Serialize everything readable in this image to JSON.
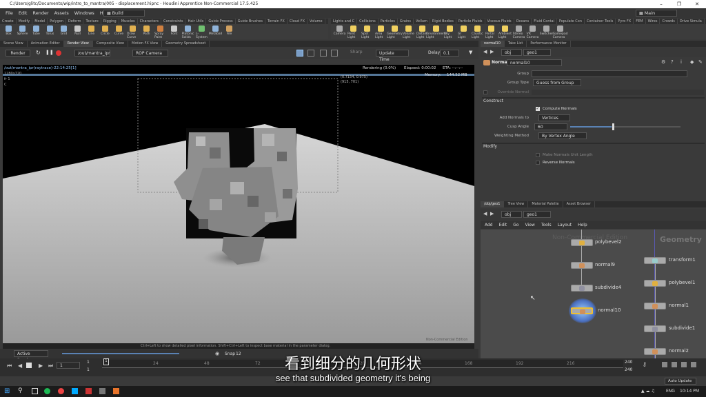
{
  "window": {
    "title": "C:/Users/glitc/Documents/wip/intro_to_mantra/005 - displacement.hipnc - Houdini Apprentice Non-Commercial 17.5.425"
  },
  "menu": [
    "File",
    "Edit",
    "Render",
    "Assets",
    "Windows",
    "Help"
  ],
  "desktop_left": "Build",
  "desktop_right": "Main",
  "shelf_tabs_left": [
    "Create",
    "Modify",
    "Model",
    "Polygon",
    "Deform",
    "Texture",
    "Rigging",
    "Muscles",
    "Characters",
    "Constraints",
    "Hair Utils",
    "Guide Process",
    "Guide Brushes",
    "Terrain FX",
    "Cloud FX",
    "Volume"
  ],
  "shelf_tools_left": [
    {
      "label": "Box",
      "color": "#8fb3d9"
    },
    {
      "label": "Sphere",
      "color": "#8fb3d9"
    },
    {
      "label": "Tube",
      "color": "#8fb3d9"
    },
    {
      "label": "Torus",
      "color": "#8fb3d9"
    },
    {
      "label": "Grid",
      "color": "#8fb3d9"
    },
    {
      "label": "Null",
      "color": "#c8c8c8"
    },
    {
      "label": "Line",
      "color": "#e0b050"
    },
    {
      "label": "Circle",
      "color": "#e0b050"
    },
    {
      "label": "Curve",
      "color": "#e0b050"
    },
    {
      "label": "Draw Curve",
      "color": "#e0b050"
    },
    {
      "label": "Path",
      "color": "#e0b050"
    },
    {
      "label": "Spray Paint",
      "color": "#d08040"
    },
    {
      "label": "Font",
      "color": "#cccccc"
    },
    {
      "label": "Platonic Solids",
      "color": "#8fb3d9"
    },
    {
      "label": "L-System",
      "color": "#70c070"
    },
    {
      "label": "Metaball",
      "color": "#8fb3d9"
    },
    {
      "label": "File",
      "color": "#d0a060"
    }
  ],
  "shelf_tabs_right": [
    "Lights and C",
    "Collisions",
    "Particles",
    "Grains",
    "Vellum",
    "Rigid Bodies",
    "Particle Fluids",
    "Viscous Fluids",
    "Oceans",
    "Fluid Contai",
    "Populate Con",
    "Container Tools",
    "Pyro FX",
    "FEM",
    "Wires",
    "Crowds",
    "Drive Simula"
  ],
  "shelf_tools_right": [
    {
      "label": "Camera",
      "color": "#aaaaaa"
    },
    {
      "label": "Point Light",
      "color": "#f0d060"
    },
    {
      "label": "Spot Light",
      "color": "#f0d060"
    },
    {
      "label": "Area Light",
      "color": "#f0d060"
    },
    {
      "label": "Geometry Light",
      "color": "#f0d060"
    },
    {
      "label": "Volume Light",
      "color": "#f0d060"
    },
    {
      "label": "Distant Light",
      "color": "#f0d060"
    },
    {
      "label": "Environment Light",
      "color": "#f0d060"
    },
    {
      "label": "Sky Light",
      "color": "#f0d060"
    },
    {
      "label": "GI Light",
      "color": "#f0d060"
    },
    {
      "label": "Caustic Light",
      "color": "#f0d060"
    },
    {
      "label": "Portal Light",
      "color": "#f0d060"
    },
    {
      "label": "Ambient Light",
      "color": "#f0d060"
    },
    {
      "label": "Stereo Camera",
      "color": "#aaaaaa"
    },
    {
      "label": "VR Camera",
      "color": "#aaaaaa"
    },
    {
      "label": "Switcher",
      "color": "#aaaaaa"
    },
    {
      "label": "Gamepad Camera",
      "color": "#aaaaaa"
    }
  ],
  "pane_tabs": [
    "Scene View",
    "Animation Editor",
    "Render View",
    "Composite View",
    "Motion FX View",
    "Geometry Spreadsheet"
  ],
  "render_toolbar": {
    "render_btn": "Render",
    "rop_path": "/out/mantra_ipr",
    "camera": "ROP Camera",
    "sharp": "Sharp",
    "update_time": "Update Time",
    "delay_label": "Delay",
    "delay_value": "0.1"
  },
  "viewer": {
    "path_info": "/out/mantra_ipr(raytrace)-22:14:25[1]",
    "resolution": "1280x720",
    "frame": "fr 1",
    "channel": "C",
    "rendering": "Rendering (0.0%)",
    "elapsed": "Elapsed: 0:00:02",
    "eta": "ETA: --:--:--",
    "memory": "Memory:",
    "memory_value": "144.52 MB",
    "pixel_coord": "(0.7154, 0.975)",
    "pixel_xy": "(915, 701)",
    "status_hint": "Ctrl+Left to show detailed pixel information. Shift+Ctrl+Left to inspect base material in the parameter dialog.",
    "watermark": "Non-Commercial Edition"
  },
  "render_footer": {
    "active_render": "Active Render",
    "snap": "Snap",
    "snap_value": "12"
  },
  "params_tabs": [
    "normal10",
    "Take List",
    "Performance Monitor"
  ],
  "params_path": {
    "obj": "obj",
    "geo": "geo1"
  },
  "params": {
    "node_type": "Normal",
    "node_name": "normal10",
    "group_label": "Group",
    "group_type_label": "Group Type",
    "group_type_value": "Guess from Group",
    "override_label": "Override Normal",
    "construct": "Construct",
    "compute_normals": "Compute Normals",
    "add_normals_label": "Add Normals to",
    "add_normals_value": "Vertices",
    "cusp_label": "Cusp Angle",
    "cusp_value": "60",
    "weighting_label": "Weighting Method",
    "weighting_value": "By Vertex Angle",
    "modify": "Modify",
    "make_unit": "Make Normals Unit Length",
    "reverse": "Reverse Normals"
  },
  "network_tabs": [
    "/obj/geo1",
    "Tree View",
    "Material Palette",
    "Asset Browser"
  ],
  "network_path": {
    "obj": "obj",
    "geo": "geo1"
  },
  "network_menu": [
    "Add",
    "Edit",
    "Go",
    "View",
    "Tools",
    "Layout",
    "Help"
  ],
  "network": {
    "watermark": "Non-Commercial Edition",
    "context": "Geometry",
    "left_nodes": [
      "polybevel2",
      "normal9",
      "subdivide4",
      "normal10"
    ],
    "right_nodes": [
      "transform1",
      "polybevel1",
      "normal1",
      "subdivide1",
      "normal2"
    ]
  },
  "timeline": {
    "frame": "1",
    "start": "1",
    "start2": "1",
    "end": "240",
    "end2": "240",
    "ticks": [
      "24",
      "48",
      "72",
      "96",
      "120",
      "144",
      "168",
      "192",
      "216"
    ],
    "auto_update": "Auto Update"
  },
  "taskbar": {
    "lang": "ENG",
    "time": "10:14 PM"
  },
  "subtitles": {
    "cn": "看到细分的几何形状",
    "en": "see that subdivided geometry it's being"
  }
}
